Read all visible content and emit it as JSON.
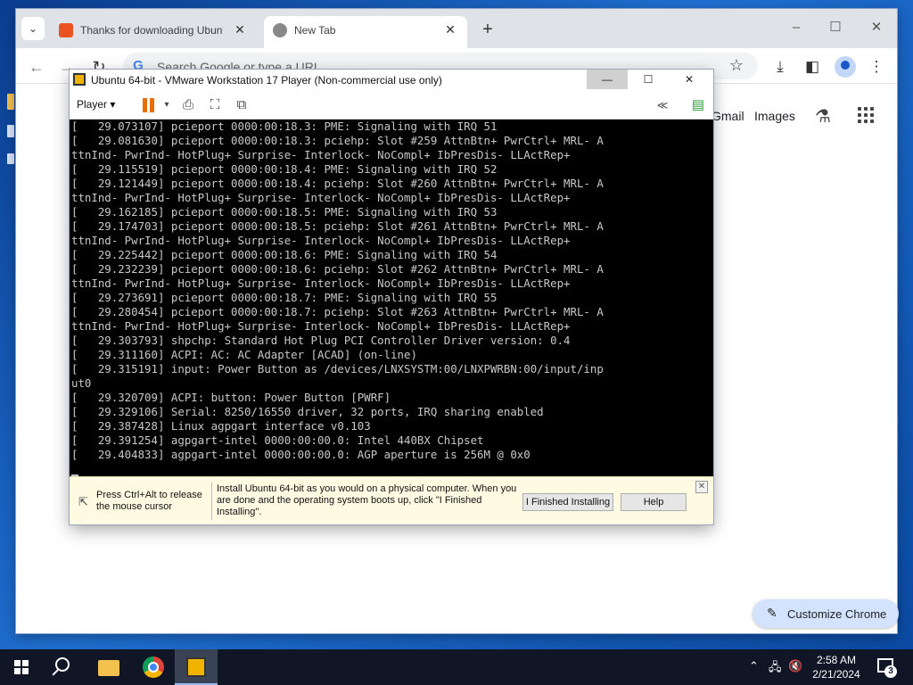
{
  "browser": {
    "tabs": [
      {
        "label": "Thanks for downloading Ubuntu",
        "active": false,
        "favicon_color": "#e95420"
      },
      {
        "label": "New Tab",
        "active": true,
        "favicon_color": "#777777"
      }
    ],
    "omnibox_placeholder": "Search Google or type a URL",
    "ntp_links": [
      "Gmail",
      "Images"
    ],
    "customize_label": "Customize Chrome"
  },
  "vmware": {
    "title": "Ubuntu 64-bit - VMware Workstation 17 Player (Non-commercial use only)",
    "player_menu": "Player",
    "console_lines": [
      "[   29.073107] pcieport 0000:00:18.3: PME: Signaling with IRQ 51",
      "[   29.081630] pcieport 0000:00:18.3: pciehp: Slot #259 AttnBtn+ PwrCtrl+ MRL- A",
      "ttnInd- PwrInd- HotPlug+ Surprise- Interlock- NoCompl+ IbPresDis- LLActRep+",
      "[   29.115519] pcieport 0000:00:18.4: PME: Signaling with IRQ 52",
      "[   29.121449] pcieport 0000:00:18.4: pciehp: Slot #260 AttnBtn+ PwrCtrl+ MRL- A",
      "ttnInd- PwrInd- HotPlug+ Surprise- Interlock- NoCompl+ IbPresDis- LLActRep+",
      "[   29.162185] pcieport 0000:00:18.5: PME: Signaling with IRQ 53",
      "[   29.174703] pcieport 0000:00:18.5: pciehp: Slot #261 AttnBtn+ PwrCtrl+ MRL- A",
      "ttnInd- PwrInd- HotPlug+ Surprise- Interlock- NoCompl+ IbPresDis- LLActRep+",
      "[   29.225442] pcieport 0000:00:18.6: PME: Signaling with IRQ 54",
      "[   29.232239] pcieport 0000:00:18.6: pciehp: Slot #262 AttnBtn+ PwrCtrl+ MRL- A",
      "ttnInd- PwrInd- HotPlug+ Surprise- Interlock- NoCompl+ IbPresDis- LLActRep+",
      "[   29.273691] pcieport 0000:00:18.7: PME: Signaling with IRQ 55",
      "[   29.280454] pcieport 0000:00:18.7: pciehp: Slot #263 AttnBtn+ PwrCtrl+ MRL- A",
      "ttnInd- PwrInd- HotPlug+ Surprise- Interlock- NoCompl+ IbPresDis- LLActRep+",
      "[   29.303793] shpchp: Standard Hot Plug PCI Controller Driver version: 0.4",
      "[   29.311160] ACPI: AC: AC Adapter [ACAD] (on-line)",
      "[   29.315191] input: Power Button as /devices/LNXSYSTM:00/LNXPWRBN:00/input/inp",
      "ut0",
      "[   29.320709] ACPI: button: Power Button [PWRF]",
      "[   29.329106] Serial: 8250/16550 driver, 32 ports, IRQ sharing enabled",
      "[   29.387428] Linux agpgart interface v0.103",
      "[   29.391254] agpgart-intel 0000:00:00.0: Intel 440BX Chipset",
      "[   29.404833] agpgart-intel 0000:00:00.0: AGP aperture is 256M @ 0x0"
    ],
    "hint_release": "Press Ctrl+Alt to release the mouse cursor",
    "hint_message": "Install Ubuntu 64-bit as you would on a physical computer. When you are done and the operating system boots up, click \"I Finished Installing\".",
    "finished_button": "I Finished Installing",
    "help_button": "Help"
  },
  "taskbar": {
    "time": "2:58 AM",
    "date": "2/21/2024",
    "notification_count": "3"
  }
}
